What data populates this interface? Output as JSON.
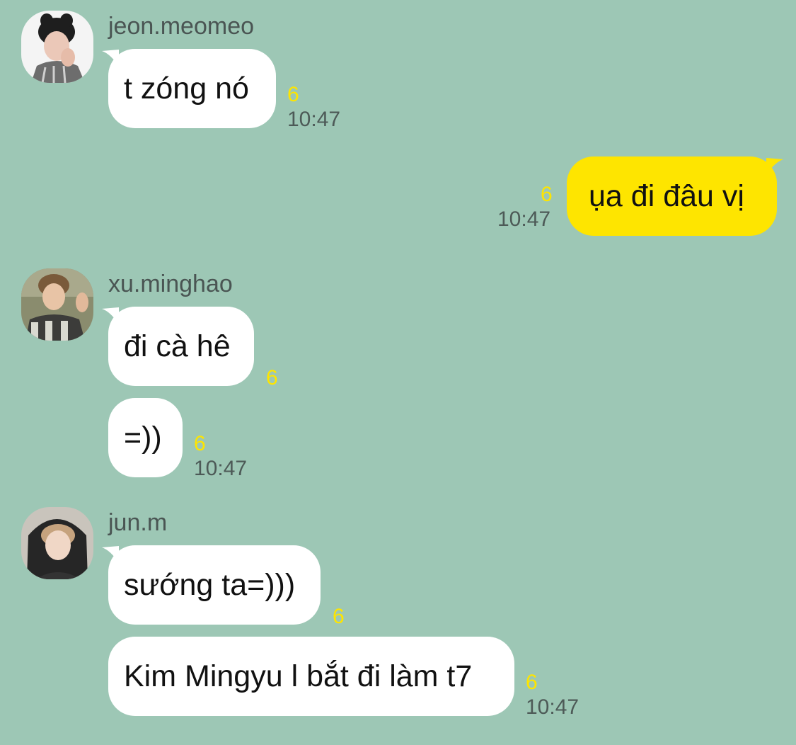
{
  "colors": {
    "background": "#9dc7b5",
    "incoming_bubble": "#ffffff",
    "outgoing_bubble": "#fee500",
    "unread_count": "#fee500",
    "timestamp": "#4d5a57"
  },
  "messages": [
    {
      "sender": "jeon.meomeo",
      "avatar": "profile-photo-avatar",
      "text": "t zóng nó",
      "unread": "6",
      "time": "10:47"
    },
    {
      "sender": "me",
      "text": "ụa đi đâu vị",
      "unread": "6",
      "time": "10:47"
    },
    {
      "sender": "xu.minghao",
      "avatar": "profile-photo-avatar",
      "text": "đi cà hê",
      "unread": "6"
    },
    {
      "sender": "xu.minghao",
      "text": "=))",
      "unread": "6",
      "time": "10:47"
    },
    {
      "sender": "jun.m",
      "avatar": "profile-photo-avatar",
      "text": "sướng ta=)))",
      "unread": "6"
    },
    {
      "sender": "jun.m",
      "text": "Kim Mingyu l bắt đi làm t7",
      "unread": "6",
      "time": "10:47"
    }
  ]
}
